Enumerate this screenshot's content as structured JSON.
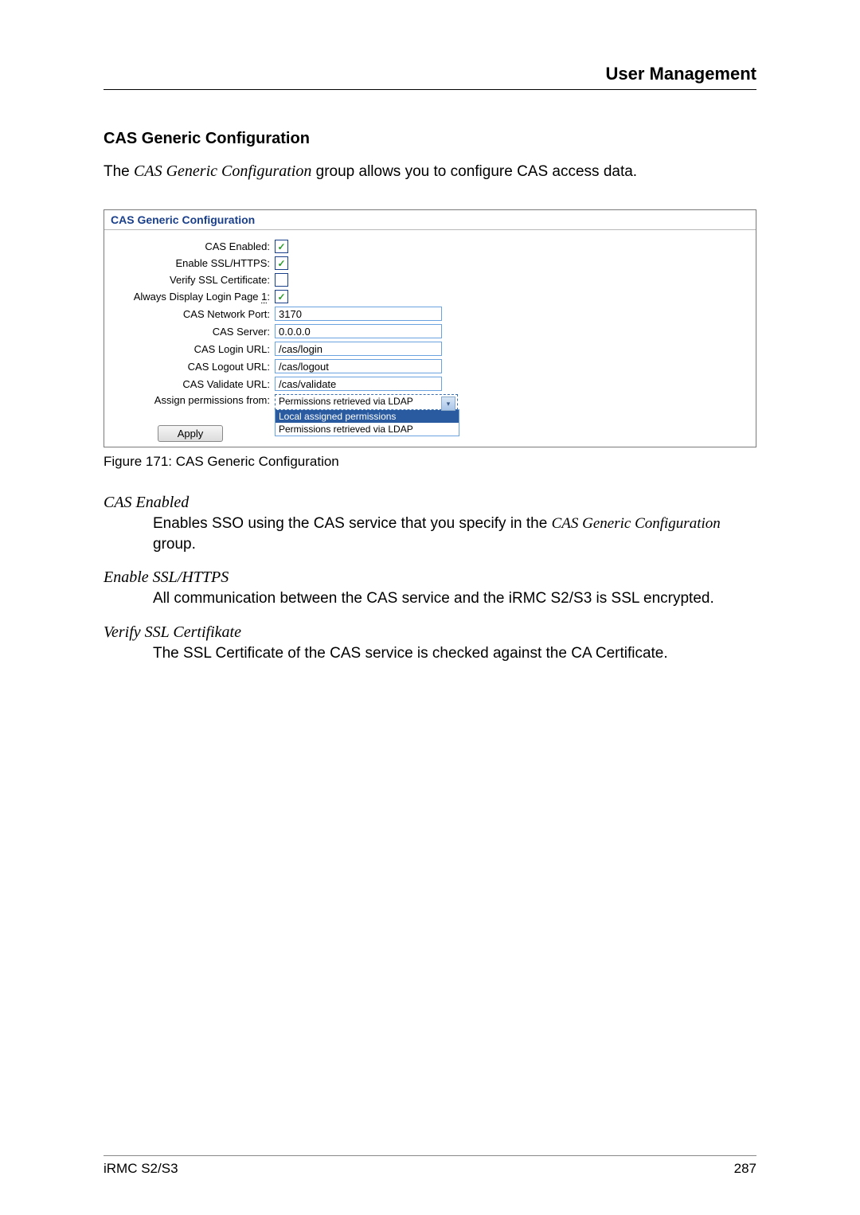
{
  "header": {
    "chapter_title": "User Management"
  },
  "section": {
    "heading": "CAS Generic Configuration",
    "intro_prefix": "The ",
    "intro_italic": "CAS Generic Configuration",
    "intro_suffix": " group allows you to configure CAS access data."
  },
  "config_box": {
    "title": "CAS Generic Configuration",
    "rows": {
      "cas_enabled": {
        "label": "CAS Enabled:",
        "checked": true
      },
      "enable_ssl": {
        "label": "Enable SSL/HTTPS:",
        "checked": true
      },
      "verify_ssl": {
        "label": "Verify SSL Certificate:",
        "checked": false
      },
      "always_login": {
        "label": "Always Display Login Page ",
        "note": "1",
        "suffix": ":",
        "checked": true
      },
      "network_port": {
        "label": "CAS Network Port:",
        "value": "3170"
      },
      "cas_server": {
        "label": "CAS Server:",
        "value": "0.0.0.0"
      },
      "login_url": {
        "label": "CAS Login URL:",
        "value": "/cas/login"
      },
      "logout_url": {
        "label": "CAS Logout URL:",
        "value": "/cas/logout"
      },
      "validate_url": {
        "label": "CAS Validate URL:",
        "value": "/cas/validate"
      },
      "assign_perms": {
        "label": "Assign permissions from:",
        "selected": "Permissions retrieved via LDAP",
        "options": [
          "Local assigned permissions",
          "Permissions retrieved via LDAP"
        ],
        "selected_index": 0
      }
    },
    "apply_label": "Apply"
  },
  "figure_caption": "Figure 171: CAS Generic Configuration",
  "defs": {
    "d1_term": "CAS Enabled",
    "d1_desc_1": "Enables SSO using the CAS service that you specify in the ",
    "d1_desc_italic": "CAS Generic Configuration",
    "d1_desc_2": " group.",
    "d2_term": "Enable SSL/HTTPS",
    "d2_desc": "All communication between the CAS service and the iRMC S2/S3 is SSL encrypted.",
    "d3_term": "Verify SSL Certifikate",
    "d3_desc": "The SSL Certificate of the CAS service is checked against the CA Certificate."
  },
  "footer": {
    "left": "iRMC S2/S3",
    "right": "287"
  }
}
